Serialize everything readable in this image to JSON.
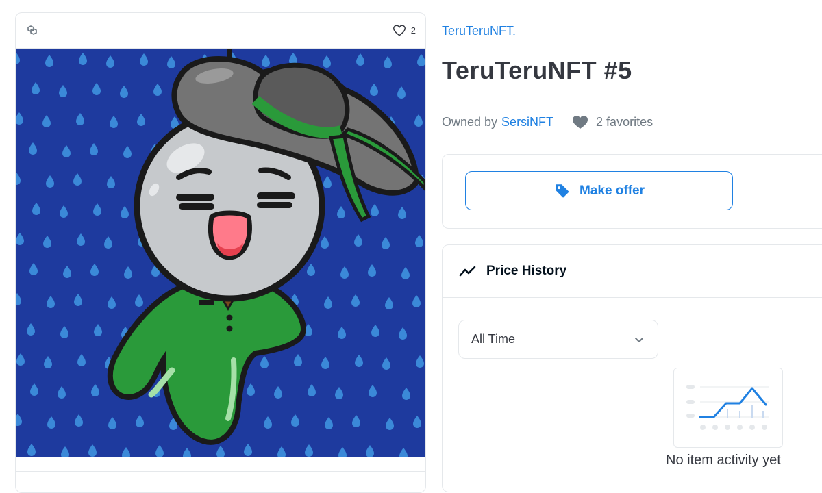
{
  "asset": {
    "favorite_count": "2",
    "collection": "TeruTeruNFT.",
    "title": "TeruTeruNFT #5",
    "owned_by_label": "Owned by",
    "owner": "SersiNFT",
    "favorites_text": "2 favorites"
  },
  "offer": {
    "button_label": "Make offer"
  },
  "price_history": {
    "title": "Price History",
    "time_filter": "All Time",
    "empty_text": "No item activity yet"
  },
  "colors": {
    "accent": "#2081e2",
    "art_background": "#1e3a9e",
    "raindrop": "#3b89d8",
    "body_green": "#2a9a3a",
    "hat_gray": "#747474"
  },
  "icons": {
    "chain": "polygon-chain-icon",
    "heart": "heart-outline-icon",
    "favorites": "heart-filled-icon",
    "offer": "price-tag-icon",
    "history": "trending-line-icon",
    "dropdown": "chevron-down-icon"
  }
}
